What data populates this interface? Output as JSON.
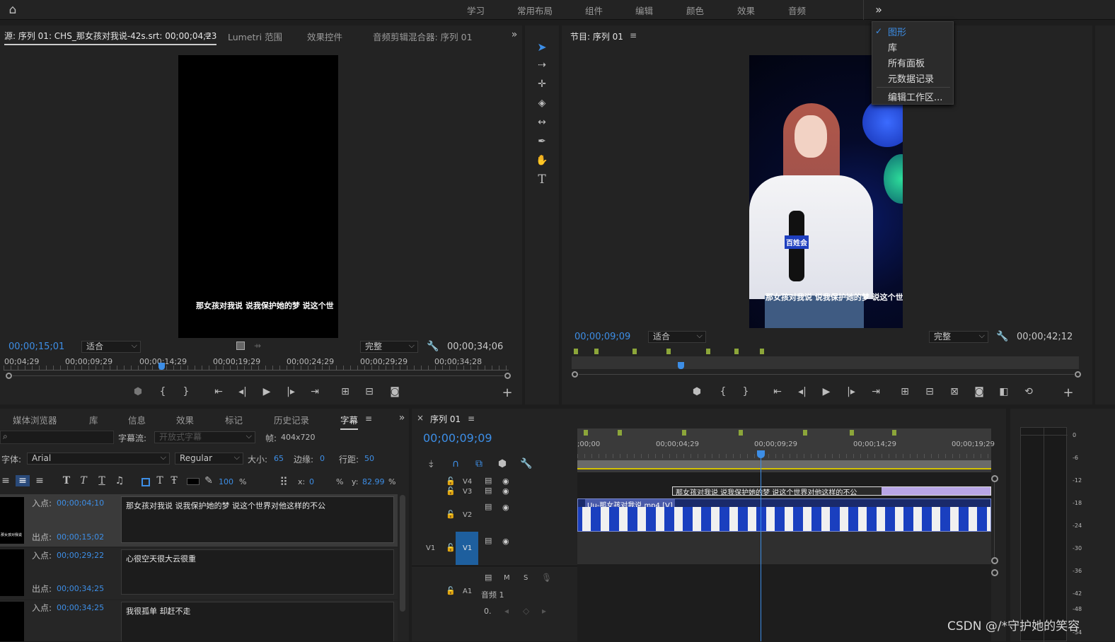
{
  "topbar": {
    "menu": [
      "学习",
      "常用布局",
      "组件",
      "编辑",
      "颜色",
      "效果",
      "音频"
    ],
    "more": "»"
  },
  "dropdown": {
    "items": [
      "图形",
      "库",
      "所有面板",
      "元数据记录",
      "编辑工作区..."
    ],
    "checked": "✓"
  },
  "source": {
    "tabs": [
      "源: 序列 01: CHS_那女孩对我说-42s.srt: 00;00;04;23",
      "Lumetri 范围",
      "效果控件",
      "音频剪辑混合器: 序列 01"
    ],
    "menu_icon": "≡",
    "more": "»",
    "subtitle": "那女孩对我说 说我保护她的梦 说这个世",
    "timecode": "00;00;15;01",
    "fit": "适合",
    "quality": "完整",
    "duration": "00;00;34;06",
    "ruler": [
      "00;04;29",
      "00;00;09;29",
      "00;00;14;29",
      "00;00;19;29",
      "00;00;24;29",
      "00;00;29;29",
      "00;00;34;28"
    ]
  },
  "program": {
    "title": "节目: 序列 01",
    "menu_icon": "≡",
    "subtitle": "那女孩对我说 说我保护她的梦 说这个世",
    "mic_text": "百姓会",
    "timecode": "00;00;09;09",
    "fit": "适合",
    "quality": "完整",
    "duration": "00;00;42;12"
  },
  "project": {
    "tabs": [
      "媒体浏览器",
      "库",
      "信息",
      "效果",
      "标记",
      "历史记录",
      "字幕"
    ],
    "menu_icon": "≡",
    "more": "»",
    "stream_label": "字幕流:",
    "stream_value": "开放式字幕",
    "frame_label": "帧:",
    "frame_value": "404x720",
    "font_label": "字体:",
    "font_value": "Arial",
    "style_value": "Regular",
    "size_label": "大小:",
    "size_value": "65",
    "edge_label": "边缘:",
    "edge_value": "0",
    "line_label": "行距:",
    "line_value": "50",
    "opacity": "100",
    "pct": "%",
    "x_label": "x:",
    "x_value": "0",
    "y_label": "y:",
    "y_value": "82.99",
    "captions": [
      {
        "in_label": "入点:",
        "in": "00;00;04;10",
        "out_label": "出点:",
        "out": "00;00;15;02",
        "text": "那女孩对我说 说我保护她的梦 说这个世界对他这样的不公",
        "thumb": "那女孩对我说"
      },
      {
        "in_label": "入点:",
        "in": "00;00;29;22",
        "out_label": "出点:",
        "out": "00;00;34;25",
        "text": "心很空天很大云很重",
        "thumb": ""
      },
      {
        "in_label": "入点:",
        "in": "00;00;34;25",
        "out_label": "",
        "out": "",
        "text": "我很孤单 却赶不走",
        "thumb": ""
      }
    ]
  },
  "timeline": {
    "close": "×",
    "title": "序列 01",
    "menu_icon": "≡",
    "timecode": "00;00;09;09",
    "ruler": [
      ";00;00",
      "00;00;04;29",
      "00;00;09;29",
      "00;00;14;29",
      "00;00;19;29"
    ],
    "tracks": [
      "V4",
      "V3",
      "V2",
      "V1",
      "A1"
    ],
    "src_v1": "V1",
    "src_a1": "A1",
    "mute": "M",
    "solo": "S",
    "audio_name": "音频 1",
    "audio_vol": "0.",
    "clip_video": "Uu-那女孩对我说.mp4 [V]",
    "clip_sub": "那女孩对我说 说我保护她的梦 说这个世界对他这样的不公"
  },
  "meter": {
    "labels": [
      "0",
      "-6",
      "-12",
      "-18",
      "-24",
      "-30",
      "-36",
      "-42",
      "-48",
      "-54"
    ]
  },
  "watermark": "CSDN @/*守护她的笑容"
}
